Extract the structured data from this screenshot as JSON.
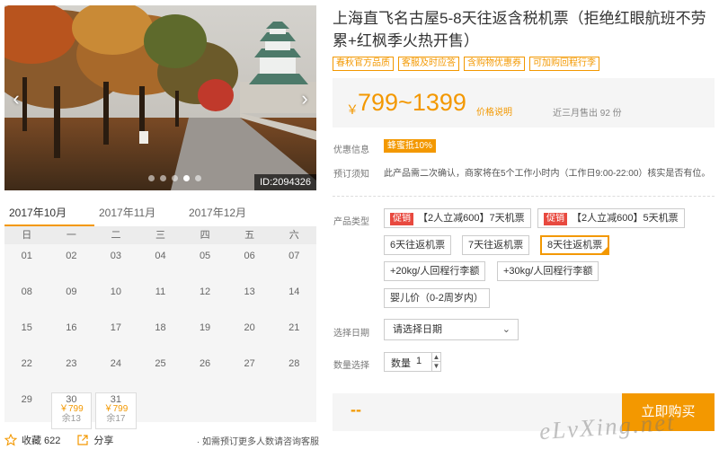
{
  "gallery": {
    "image_id": "ID:2094326",
    "prev_icon": "chevron-left-icon",
    "next_icon": "chevron-right-icon",
    "dots": [
      false,
      false,
      false,
      true,
      false
    ],
    "palette": {
      "sky": "#c9c7c2",
      "autumn_leaves": "#b8541e",
      "path": "#9a9590",
      "castle": "#e8ece8"
    }
  },
  "calendar": {
    "months": [
      "2017年10月",
      "2017年11月",
      "2017年12月"
    ],
    "active_month": 0,
    "weekdays": [
      "日",
      "一",
      "二",
      "三",
      "四",
      "五",
      "六"
    ],
    "days": [
      {
        "d": "01"
      },
      {
        "d": "02"
      },
      {
        "d": "03"
      },
      {
        "d": "04"
      },
      {
        "d": "05"
      },
      {
        "d": "06"
      },
      {
        "d": "07"
      },
      {
        "d": "08"
      },
      {
        "d": "09"
      },
      {
        "d": "10"
      },
      {
        "d": "11"
      },
      {
        "d": "12"
      },
      {
        "d": "13"
      },
      {
        "d": "14"
      },
      {
        "d": "15"
      },
      {
        "d": "16"
      },
      {
        "d": "17"
      },
      {
        "d": "18"
      },
      {
        "d": "19"
      },
      {
        "d": "20"
      },
      {
        "d": "21"
      },
      {
        "d": "22"
      },
      {
        "d": "23"
      },
      {
        "d": "24"
      },
      {
        "d": "25"
      },
      {
        "d": "26"
      },
      {
        "d": "27"
      },
      {
        "d": "28"
      },
      {
        "d": "29"
      },
      {
        "d": "30",
        "price": "￥799",
        "remain": "余13"
      },
      {
        "d": "31",
        "price": "￥799",
        "remain": "余17"
      }
    ]
  },
  "actions": {
    "favorite_label": "收藏 622",
    "share_label": "分享",
    "note": "· 如需预订更多人数请咨询客服"
  },
  "product": {
    "title": "上海直飞名古屋5-8天往返含税机票（拒绝红眼航班不劳累+红枫季火热开售）",
    "tags": [
      "春秋官方品质",
      "客服及时应答",
      "含购物优惠券",
      "可加购回程行李"
    ],
    "price_currency": "￥",
    "price_range": "799~1399",
    "price_explain": "价格说明",
    "sold": "近三月售出 92 份",
    "discount_label": "优惠信息",
    "discount_badge": "蜂蜜抵10%",
    "booking_label": "预订须知",
    "booking_note": "此产品需二次确认，商家将在5个工作小时内（工作日9:00-22:00）核实是否有位。"
  },
  "options": {
    "label": "产品类型",
    "promo_badge": "促销",
    "promo_items": [
      "【2人立减600】7天机票",
      "【2人立减600】5天机票"
    ],
    "items": [
      "6天往返机票",
      "7天往返机票",
      "8天往返机票",
      "+20kg/人回程行李额",
      "+30kg/人回程行李额",
      "婴儿价（0-2周岁内）"
    ],
    "selected": "8天往返机票"
  },
  "date": {
    "label": "选择日期",
    "placeholder": "请选择日期"
  },
  "quantity": {
    "label": "数量选择",
    "prefix": "数量",
    "value": "1",
    "up": "▲",
    "down": "▼"
  },
  "purchase": {
    "total": "--",
    "button": "立即购买"
  },
  "watermark": "eLvXing.net",
  "colors": {
    "accent": "#f39800",
    "promo": "#e8493f",
    "panel": "#f5f5f5"
  }
}
